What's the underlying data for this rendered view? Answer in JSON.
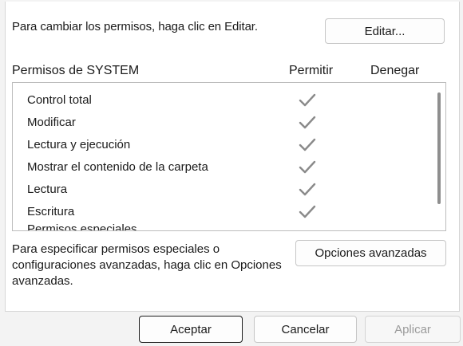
{
  "hint_text": "Para cambiar los permisos, haga clic en Editar.",
  "edit_button": "Editar...",
  "permissions": {
    "header_name": "Permisos de SYSTEM",
    "header_allow": "Permitir",
    "header_deny": "Denegar",
    "items": [
      {
        "label": "Control total",
        "allow": true,
        "deny": false
      },
      {
        "label": "Modificar",
        "allow": true,
        "deny": false
      },
      {
        "label": "Lectura y ejecución",
        "allow": true,
        "deny": false
      },
      {
        "label": "Mostrar el contenido de la carpeta",
        "allow": true,
        "deny": false
      },
      {
        "label": "Lectura",
        "allow": true,
        "deny": false
      },
      {
        "label": "Escritura",
        "allow": true,
        "deny": false
      },
      {
        "label": "Permisos especiales",
        "allow": false,
        "deny": false
      }
    ]
  },
  "advanced": {
    "text": "Para especificar permisos especiales o configuraciones avanzadas, haga clic en Opciones avanzadas.",
    "button": "Opciones avanzadas"
  },
  "footer": {
    "ok": "Aceptar",
    "cancel": "Cancelar",
    "apply": "Aplicar"
  },
  "colors": {
    "check": "#8a8a8a",
    "scrollbar": "#8e8e8e"
  },
  "icons": {
    "check": "checkmark-icon"
  }
}
